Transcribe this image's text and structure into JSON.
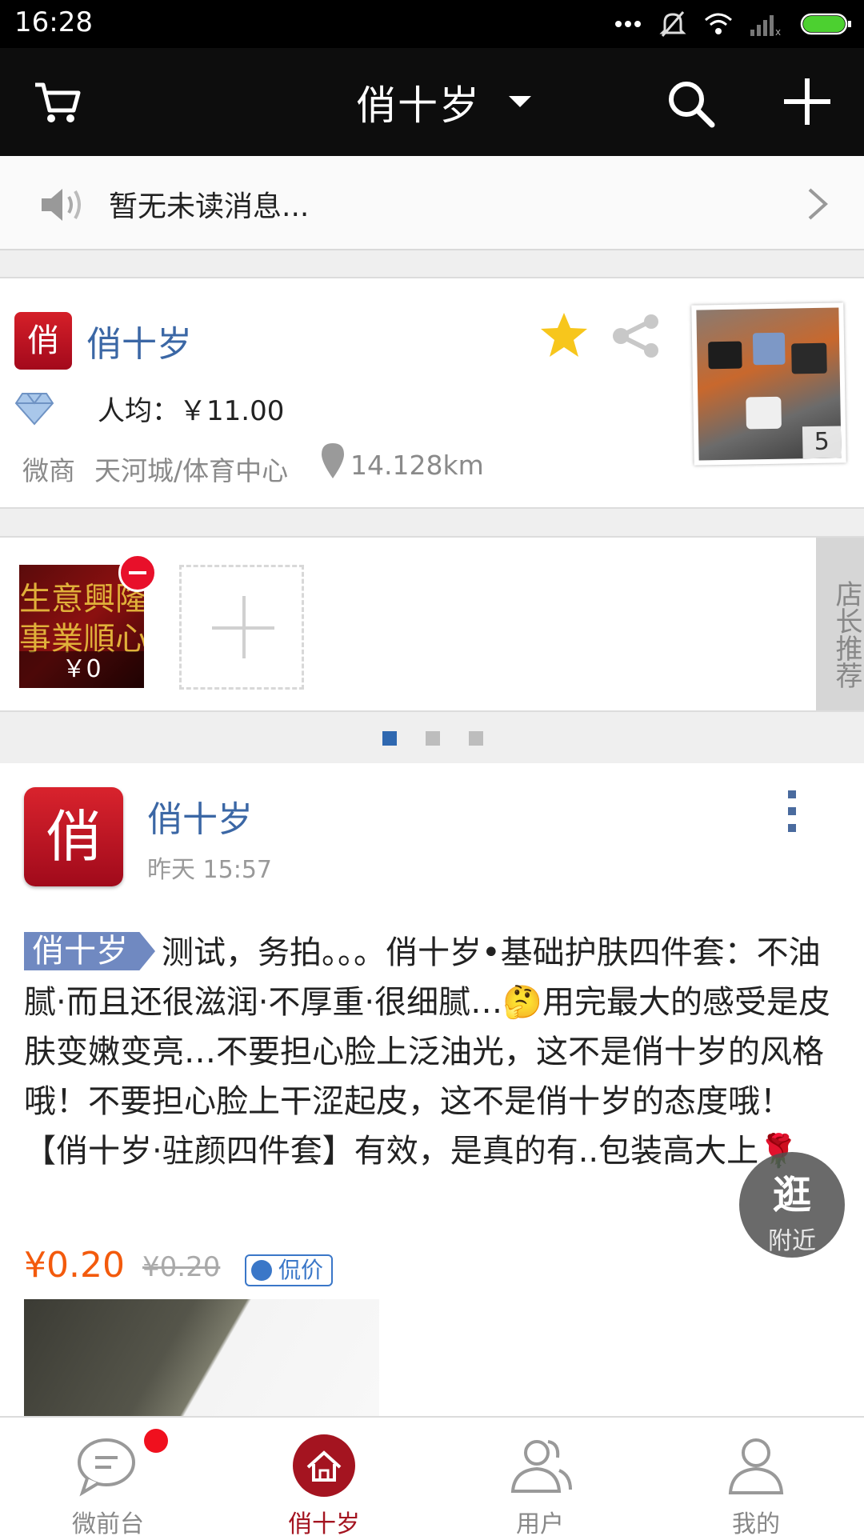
{
  "status_bar": {
    "time": "16:28"
  },
  "nav": {
    "title": "俏十岁"
  },
  "notice": {
    "text": "暂无未读消息..."
  },
  "shop": {
    "logo_char": "俏",
    "name": "俏十岁",
    "avg_price": "人均：￥11.00",
    "category": "微商",
    "area": "天河城/体育中心",
    "distance": "14.128km",
    "photo_count": "5"
  },
  "recommend": {
    "thumb_text_1": "生意興隆",
    "thumb_text_2": "事業順心",
    "item_price": "￥0",
    "side_label": "店长推荐"
  },
  "pager": {
    "count": 3,
    "active": 0
  },
  "post": {
    "avatar_char": "俏",
    "author": "俏十岁",
    "time": "昨天 15:57",
    "tag": "俏十岁",
    "content": "测试，务拍。。。俏十岁•基础护肤四件套：不油腻·而且还很滋润·不厚重·很细腻…🤔用完最大的感受是皮肤变嫩变亮…不要担心脸上泛油光，这不是俏十岁的风格哦！不要担心脸上干涩起皮，这不是俏十岁的态度哦！【俏十岁·驻颜四件套】有效，是真的有..包装高大上🌹",
    "price": "¥0.20",
    "old_price": "¥0.20",
    "bargain_label": "侃价"
  },
  "nearby": {
    "big": "逛",
    "small": "附近"
  },
  "tabs": [
    {
      "label": "微前台",
      "icon": "chat-icon",
      "badge": true
    },
    {
      "label": "俏十岁",
      "icon": "home-icon",
      "active": true
    },
    {
      "label": "用户",
      "icon": "users-icon"
    },
    {
      "label": "我的",
      "icon": "person-icon"
    }
  ],
  "colors": {
    "brand_red": "#a41420",
    "link_blue": "#3b67a5",
    "price_orange": "#f35a0c"
  }
}
